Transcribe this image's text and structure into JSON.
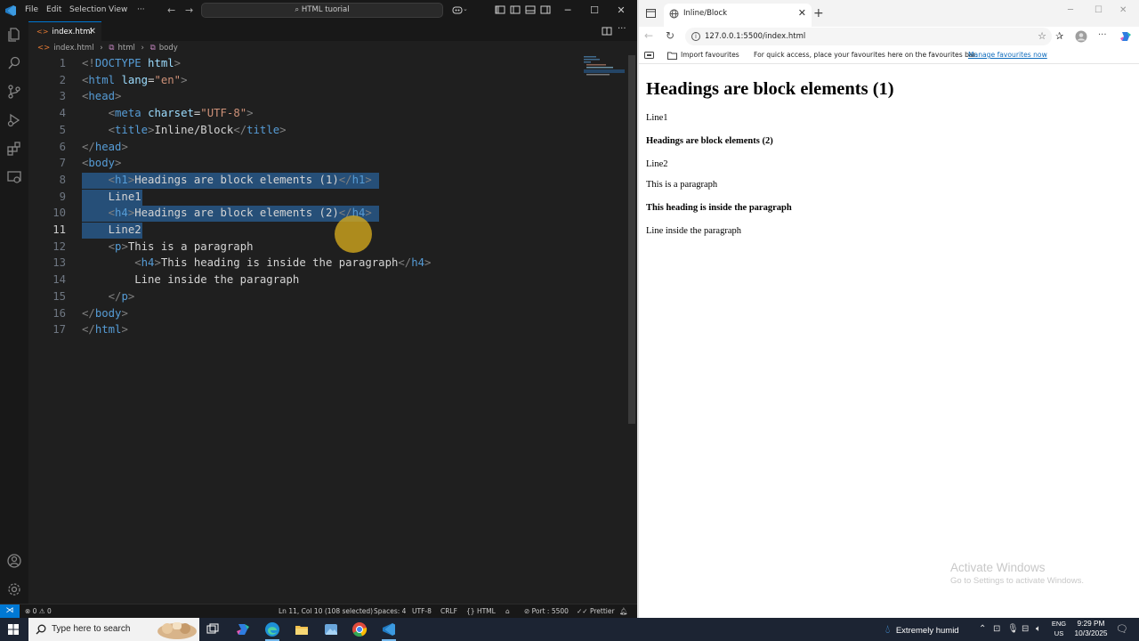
{
  "vscode": {
    "menu": [
      "File",
      "Edit",
      "Selection",
      "View",
      "···"
    ],
    "command_center": "HTML tuorial",
    "tab": {
      "name": "index.html"
    },
    "breadcrumb": [
      "index.html",
      "html",
      "body"
    ],
    "code_lines": [
      {
        "n": "1",
        "parts": [
          [
            "br",
            "<!"
          ],
          [
            "tag",
            "DOCTYPE "
          ],
          [
            "attr",
            "html"
          ],
          [
            "br",
            ">"
          ]
        ]
      },
      {
        "n": "2",
        "parts": [
          [
            "br",
            "<"
          ],
          [
            "tag",
            "html "
          ],
          [
            "attr",
            "lang"
          ],
          [
            "txt",
            "="
          ],
          [
            "str",
            "\"en\""
          ],
          [
            "br",
            ">"
          ]
        ]
      },
      {
        "n": "3",
        "parts": [
          [
            "br",
            "<"
          ],
          [
            "tag",
            "head"
          ],
          [
            "br",
            ">"
          ]
        ]
      },
      {
        "n": "4",
        "parts": [
          [
            "txt",
            "    "
          ],
          [
            "br",
            "<"
          ],
          [
            "tag",
            "meta "
          ],
          [
            "attr",
            "charset"
          ],
          [
            "txt",
            "="
          ],
          [
            "str",
            "\"UTF-8\""
          ],
          [
            "br",
            ">"
          ]
        ]
      },
      {
        "n": "5",
        "parts": [
          [
            "txt",
            "    "
          ],
          [
            "br",
            "<"
          ],
          [
            "tag",
            "title"
          ],
          [
            "br",
            ">"
          ],
          [
            "txt",
            "Inline/Block"
          ],
          [
            "br",
            "</"
          ],
          [
            "tag",
            "title"
          ],
          [
            "br",
            ">"
          ]
        ]
      },
      {
        "n": "6",
        "parts": [
          [
            "br",
            "</"
          ],
          [
            "tag",
            "head"
          ],
          [
            "br",
            ">"
          ]
        ]
      },
      {
        "n": "7",
        "parts": [
          [
            "br",
            "<"
          ],
          [
            "tag",
            "body"
          ],
          [
            "br",
            ">"
          ]
        ]
      },
      {
        "n": "8",
        "parts": [
          [
            "txt",
            "    "
          ],
          [
            "br",
            "<"
          ],
          [
            "tag",
            "h1"
          ],
          [
            "br",
            ">"
          ],
          [
            "txt",
            "Headings are block elements (1)"
          ],
          [
            "br",
            "</"
          ],
          [
            "tag",
            "h1"
          ],
          [
            "br",
            ">"
          ]
        ]
      },
      {
        "n": "9",
        "parts": [
          [
            "txt",
            "    Line1"
          ]
        ]
      },
      {
        "n": "10",
        "parts": [
          [
            "txt",
            "    "
          ],
          [
            "br",
            "<"
          ],
          [
            "tag",
            "h4"
          ],
          [
            "br",
            ">"
          ],
          [
            "txt",
            "Headings are block elements (2)"
          ],
          [
            "br",
            "</"
          ],
          [
            "tag",
            "h4"
          ],
          [
            "br",
            ">"
          ]
        ]
      },
      {
        "n": "11",
        "parts": [
          [
            "txt",
            "    Line2"
          ]
        ]
      },
      {
        "n": "12",
        "parts": [
          [
            "txt",
            "    "
          ],
          [
            "br",
            "<"
          ],
          [
            "tag",
            "p"
          ],
          [
            "br",
            ">"
          ],
          [
            "txt",
            "This is a paragraph"
          ]
        ]
      },
      {
        "n": "13",
        "parts": [
          [
            "txt",
            "        "
          ],
          [
            "br",
            "<"
          ],
          [
            "tag",
            "h4"
          ],
          [
            "br",
            ">"
          ],
          [
            "txt",
            "This heading is inside the paragraph"
          ],
          [
            "br",
            "</"
          ],
          [
            "tag",
            "h4"
          ],
          [
            "br",
            ">"
          ]
        ]
      },
      {
        "n": "14",
        "parts": [
          [
            "txt",
            "        Line inside the paragraph"
          ]
        ]
      },
      {
        "n": "15",
        "parts": [
          [
            "txt",
            "    "
          ],
          [
            "br",
            "</"
          ],
          [
            "tag",
            "p"
          ],
          [
            "br",
            ">"
          ]
        ]
      },
      {
        "n": "16",
        "parts": [
          [
            "br",
            "</"
          ],
          [
            "tag",
            "body"
          ],
          [
            "br",
            ">"
          ]
        ]
      },
      {
        "n": "17",
        "parts": [
          [
            "br",
            "</"
          ],
          [
            "tag",
            "html"
          ],
          [
            "br",
            ">"
          ]
        ]
      }
    ],
    "status": {
      "errors": "0",
      "warnings": "0",
      "position": "Ln 11, Col 10 (108 selected)",
      "spaces": "Spaces: 4",
      "encoding": "UTF-8",
      "eol": "CRLF",
      "language": "HTML",
      "port": "Port : 5500",
      "prettier": "Prettier"
    },
    "colors": {
      "accent": "#0078d4",
      "selection": "#264f78",
      "tag": "#569cd6",
      "attr": "#9cdcfe",
      "string": "#ce9178"
    }
  },
  "browser": {
    "tab_title": "Inline/Block",
    "url": "127.0.0.1:5500/index.html",
    "favbar": {
      "import": "Import favourites",
      "hint": "For quick access, place your favourites here on the favourites bar.",
      "manage": "Manage favourites now"
    },
    "content": {
      "h1": "Headings are block elements (1)",
      "line1": "Line1",
      "h4_1": "Headings are block elements (2)",
      "line2": "Line2",
      "para": "This is a paragraph",
      "h4_2": "This heading is inside the paragraph",
      "line3": "Line inside the paragraph"
    },
    "watermark": {
      "title": "Activate Windows",
      "subtitle": "Go to Settings to activate Windows."
    }
  },
  "taskbar": {
    "search_placeholder": "Type here to search",
    "weather": "Extremely humid",
    "lang_top": "ENG",
    "lang_bottom": "US",
    "time": "9:29 PM",
    "date": "10/3/2025"
  }
}
